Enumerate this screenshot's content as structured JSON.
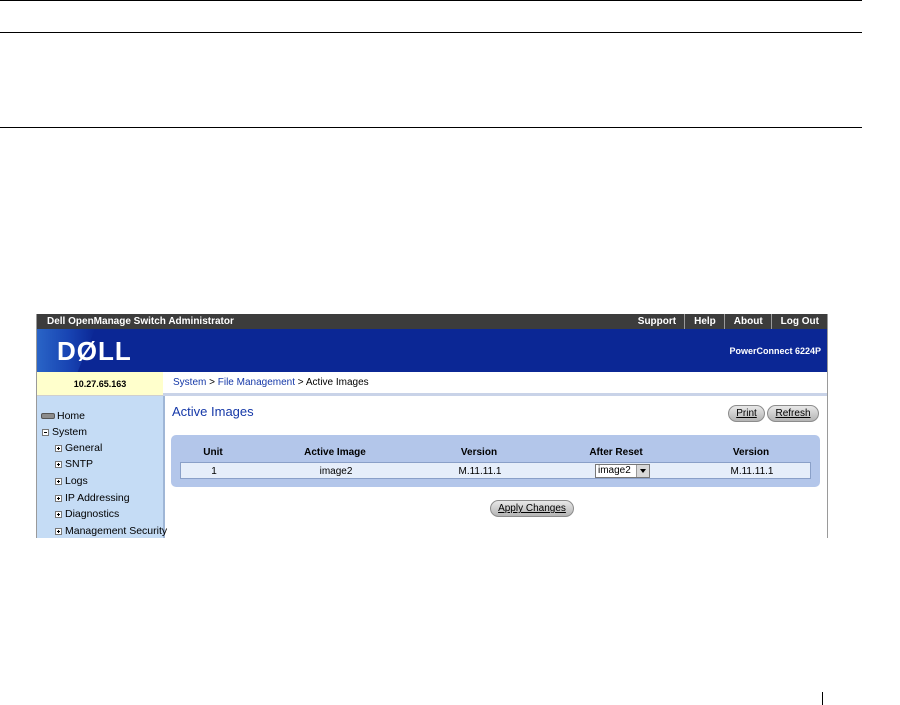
{
  "topbar": {
    "title": "Dell OpenManage Switch Administrator",
    "links": [
      "Support",
      "Help",
      "About",
      "Log Out"
    ]
  },
  "banner": {
    "logo": "DØLL",
    "model": "PowerConnect 6224P"
  },
  "ip_address": "10.27.65.163",
  "breadcrumb": {
    "items": [
      "System",
      "File Management"
    ],
    "separator": " > ",
    "current": "Active Images"
  },
  "sidebar": {
    "items": [
      {
        "label": "Home",
        "icon": "home-icon"
      },
      {
        "label": "System",
        "icon": "minus-icon"
      },
      {
        "label": "General",
        "icon": "plus-icon"
      },
      {
        "label": "SNTP",
        "icon": "plus-icon"
      },
      {
        "label": "Logs",
        "icon": "plus-icon"
      },
      {
        "label": "IP Addressing",
        "icon": "plus-icon"
      },
      {
        "label": "Diagnostics",
        "icon": "plus-icon"
      },
      {
        "label": "Management Security",
        "icon": "plus-icon"
      }
    ]
  },
  "content": {
    "title": "Active Images",
    "print_label": "Print",
    "refresh_label": "Refresh",
    "apply_label": "Apply Changes"
  },
  "table": {
    "columns": [
      "Unit",
      "Active Image",
      "Version",
      "After Reset",
      "Version"
    ],
    "rows": [
      {
        "unit": "1",
        "active_image": "image2",
        "version": "M.11.11.1",
        "after_reset": "image2",
        "after_version": "M.11.11.1"
      }
    ]
  },
  "colors": {
    "topbar_bg": "#3c3c3c",
    "banner_bg": "#0b2795",
    "sidebar_bg": "#c5dcf5",
    "table_bg": "#b3c6ea",
    "link": "#1538a8",
    "ip_bg": "#ffffcc"
  }
}
